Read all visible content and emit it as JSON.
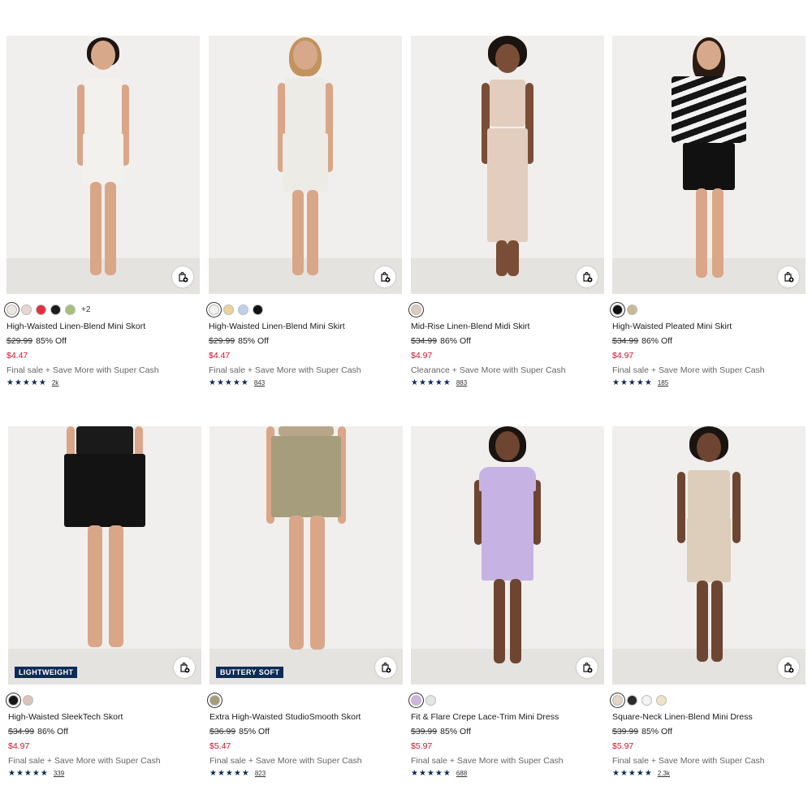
{
  "products": [
    {
      "name": "High-Waisted Linen-Blend Mini Skort",
      "original_price": "$29.99",
      "discount": "85% Off",
      "sale_price": "$4.47",
      "note": "Final sale + Save More with Super Cash",
      "rating_count": "2k",
      "badge": "",
      "more_colors": "+2",
      "swatches": [
        "#ece8e0",
        "#e7d7cf",
        "#e3303b",
        "#1b1b1b",
        "#a7c07b"
      ],
      "top_color": "#f3f1ee",
      "bottom_color": "#f3f1ee",
      "hair_color": "#1d1613"
    },
    {
      "name": "High-Waisted Linen-Blend Mini Skirt",
      "original_price": "$29.99",
      "discount": "85% Off",
      "sale_price": "$4.47",
      "note": "Final sale + Save More with Super Cash",
      "rating_count": "843",
      "badge": "",
      "more_colors": "",
      "swatches": [
        "#f3f2ee",
        "#ecd29a",
        "#bfd0ea",
        "#121212"
      ],
      "top_color": "#ecebe5",
      "bottom_color": "#ecebe5",
      "hair_color": "#c2935c"
    },
    {
      "name": "Mid-Rise Linen-Blend Midi Skirt",
      "original_price": "$34.99",
      "discount": "86% Off",
      "sale_price": "$4.97",
      "note": "Clearance + Save More with Super Cash",
      "rating_count": "883",
      "badge": "",
      "more_colors": "",
      "swatches": [
        "#dfcbbd"
      ],
      "top_color": "#e2cdbf",
      "bottom_color": "#e2cdbf",
      "hair_color": "#1a1411"
    },
    {
      "name": "High-Waisted Pleated Mini Skirt",
      "original_price": "$34.99",
      "discount": "86% Off",
      "sale_price": "$4.97",
      "note": "Final sale + Save More with Super Cash",
      "rating_count": "185",
      "badge": "",
      "more_colors": "",
      "swatches": [
        "#111111",
        "#cbb895"
      ],
      "top_color": "#151515",
      "bottom_color": "#111111",
      "hair_color": "#2a1c15"
    },
    {
      "name": "High-Waisted SleekTech Skort",
      "original_price": "$34.99",
      "discount": "86% Off",
      "sale_price": "$4.97",
      "note": "Final sale + Save More with Super Cash",
      "rating_count": "339",
      "badge": "LIGHTWEIGHT",
      "more_colors": "",
      "swatches": [
        "#151515",
        "#dcc3b8"
      ],
      "top_color": "#1a1a1a",
      "bottom_color": "#131313",
      "hair_color": ""
    },
    {
      "name": "Extra High-Waisted StudioSmooth Skort",
      "original_price": "$36.99",
      "discount": "85% Off",
      "sale_price": "$5.47",
      "note": "Final sale + Save More with Super Cash",
      "rating_count": "823",
      "badge": "BUTTERY SOFT",
      "more_colors": "",
      "swatches": [
        "#a69b7a"
      ],
      "top_color": "#b8a68a",
      "bottom_color": "#a59d7b",
      "hair_color": ""
    },
    {
      "name": "Fit & Flare Crepe Lace-Trim Mini Dress",
      "original_price": "$39.99",
      "discount": "85% Off",
      "sale_price": "$5.97",
      "note": "Final sale + Save More with Super Cash",
      "rating_count": "688",
      "badge": "",
      "more_colors": "",
      "swatches": [
        "#cbb6e0",
        "#e4e6e2"
      ],
      "top_color": "#c7b3e3",
      "bottom_color": "#c7b3e3",
      "hair_color": "#1a1411"
    },
    {
      "name": "Square-Neck Linen-Blend Mini Dress",
      "original_price": "$39.99",
      "discount": "85% Off",
      "sale_price": "$5.97",
      "note": "Final sale + Save More with Super Cash",
      "rating_count": "2.3k",
      "badge": "",
      "more_colors": "",
      "swatches": [
        "#e3d6c8",
        "#2b2b2b",
        "#f3f3f3",
        "#f0e3c4"
      ],
      "top_color": "#ddcdbb",
      "bottom_color": "#ddcdbb",
      "hair_color": "#1a1411"
    }
  ],
  "ratings_display": "★★★★★",
  "colors": {
    "sale": "#d1102b",
    "badge_bg": "#0e2b56",
    "star": "#0e2b56"
  },
  "icons": {
    "bag_add": "shopping-bag-plus-icon"
  }
}
